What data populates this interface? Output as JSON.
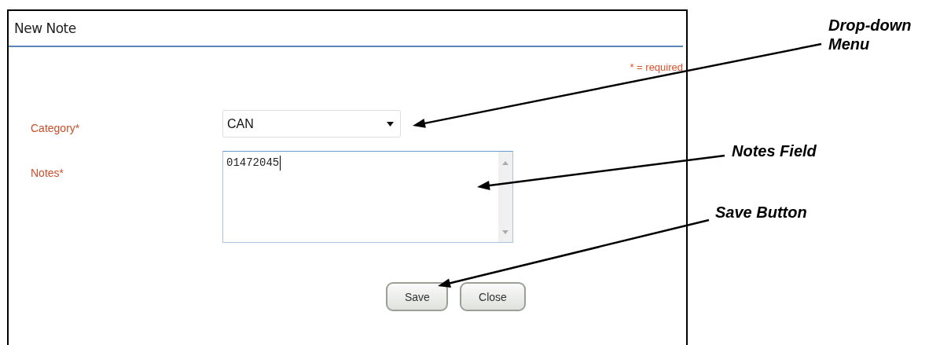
{
  "window": {
    "title": "New Note"
  },
  "required_note": "* = required",
  "fields": [
    {
      "label": "Category*",
      "kind": "select",
      "value": "CAN"
    },
    {
      "label": "Notes*",
      "kind": "textarea",
      "value": "01472045"
    }
  ],
  "buttons": [
    "Save",
    "Close"
  ],
  "callouts": [
    {
      "text": "Drop-down Menu"
    },
    {
      "text": "Notes Field"
    },
    {
      "text": "Save Button"
    }
  ]
}
